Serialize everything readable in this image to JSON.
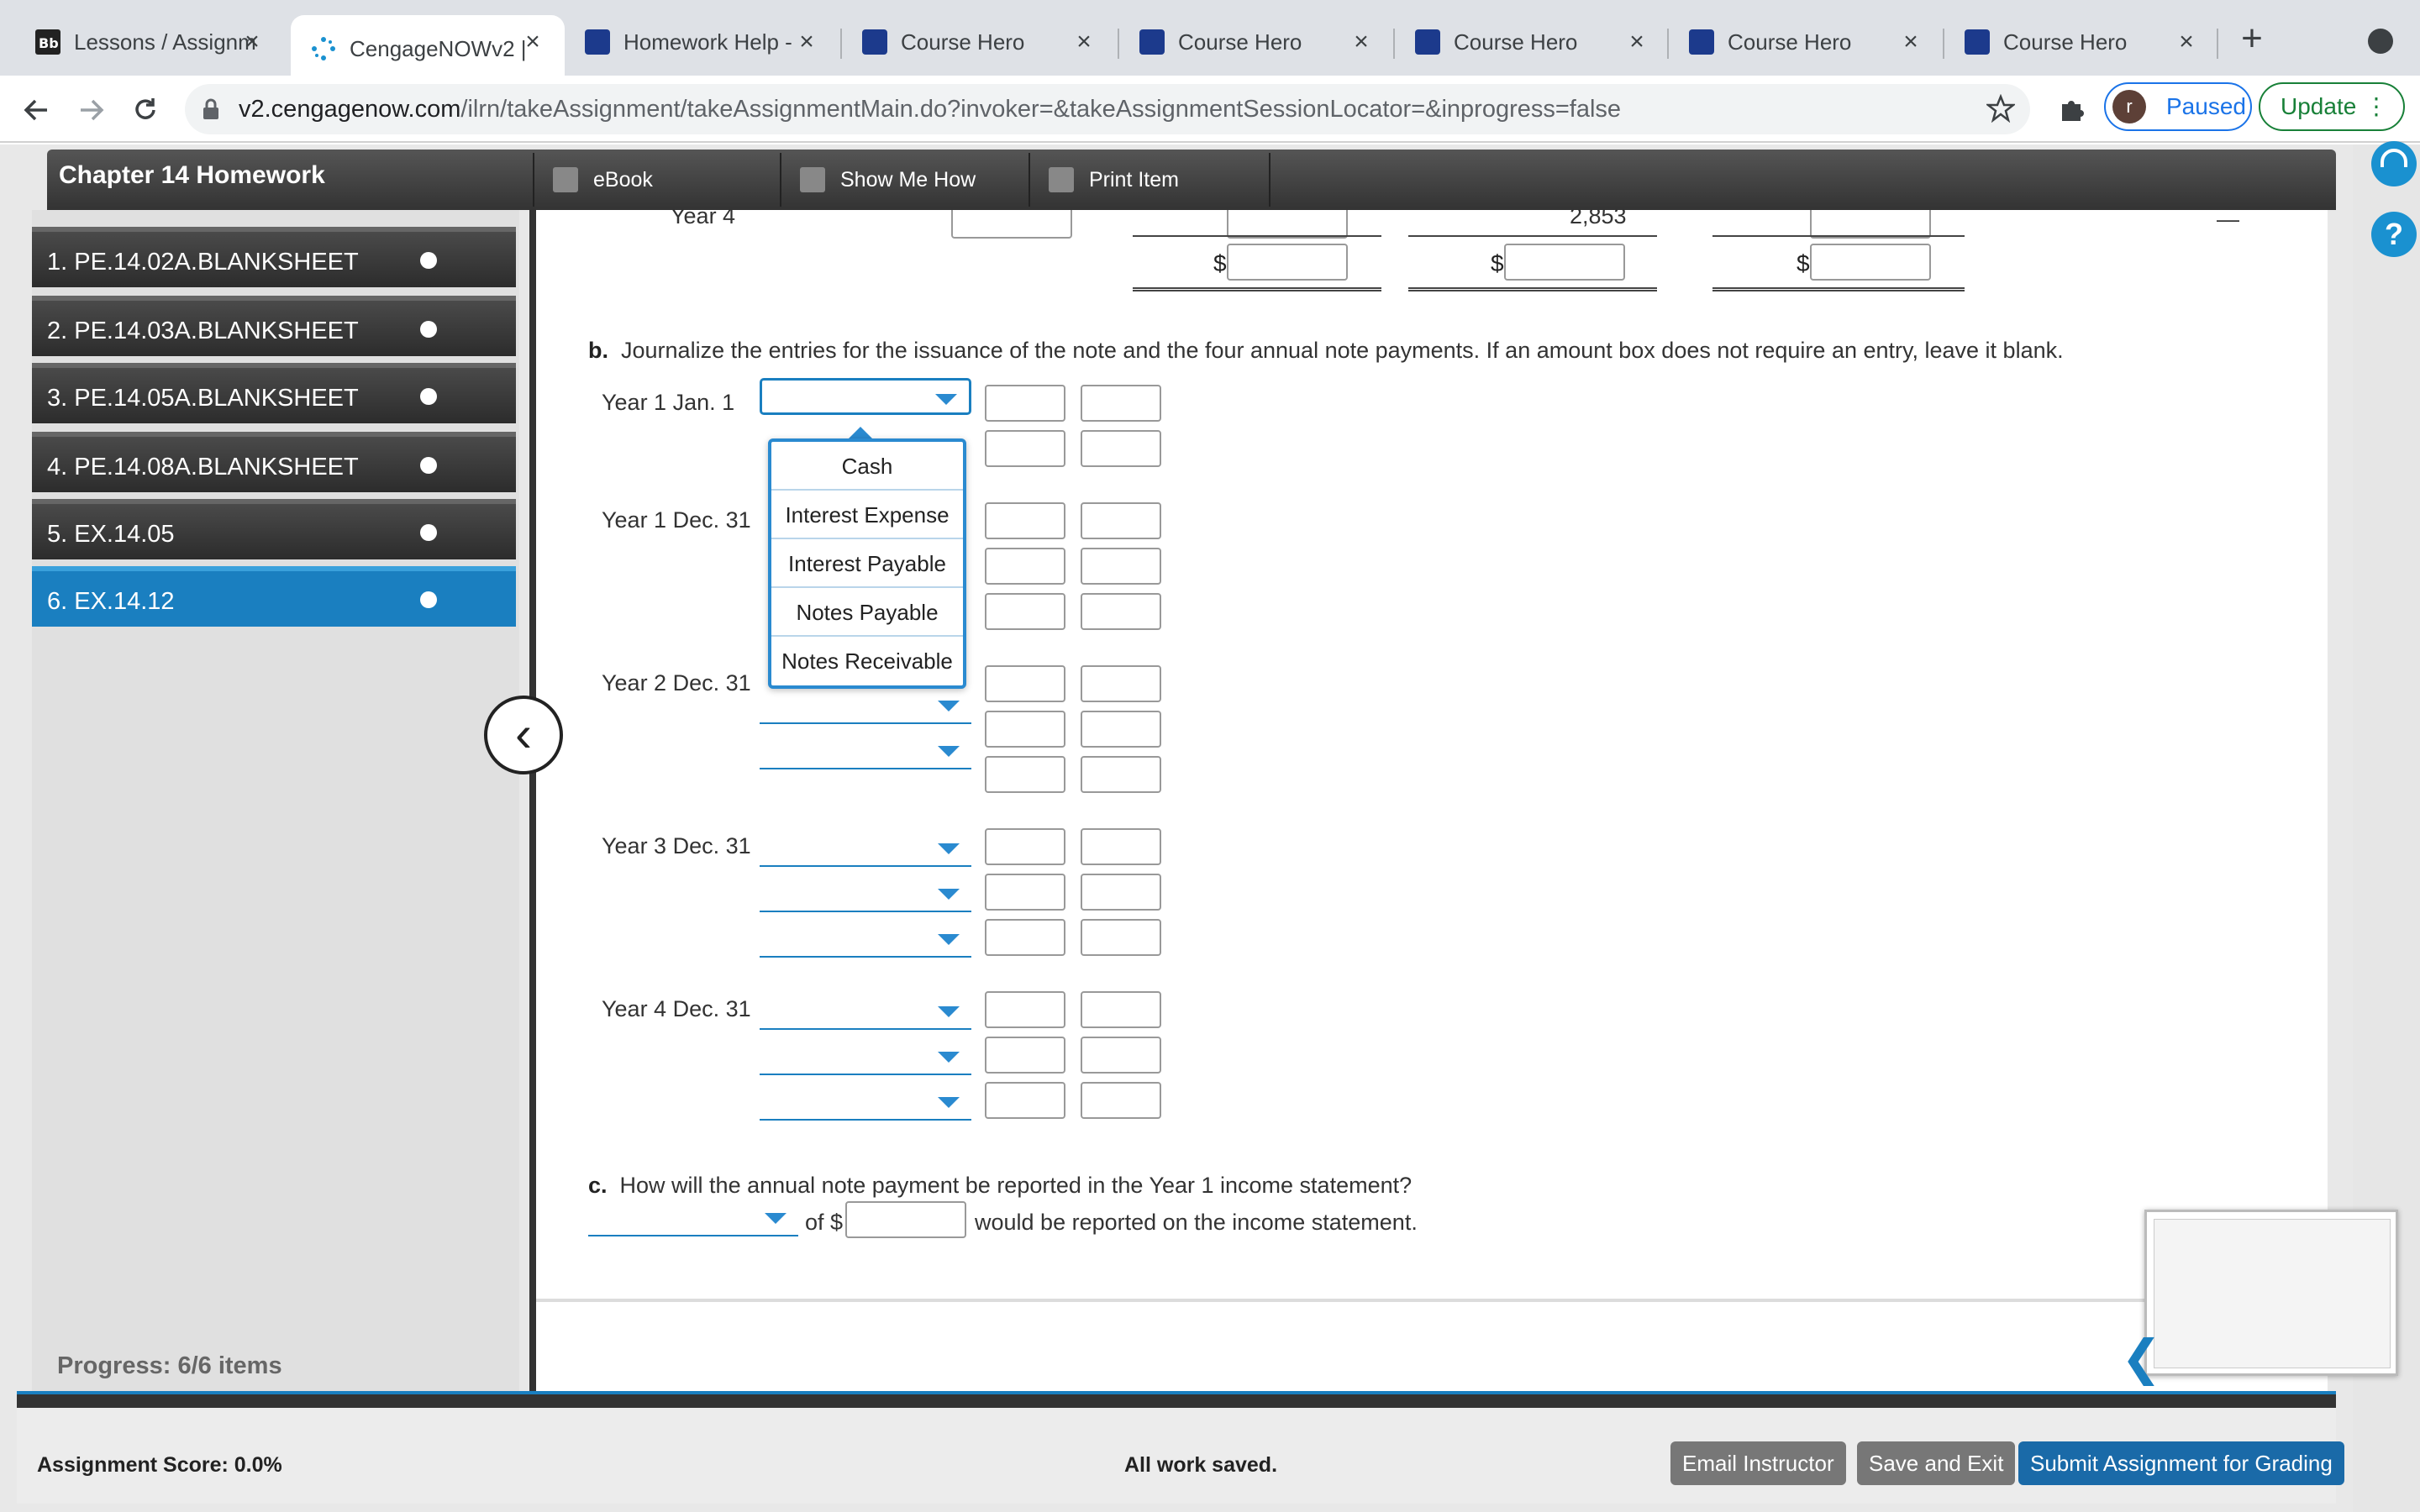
{
  "browser": {
    "tabs": [
      {
        "title": "Lessons / Assignm",
        "icon": "blackboard-icon"
      },
      {
        "title": "CengageNOWv2 |",
        "icon": "cengage-icon",
        "active": true
      },
      {
        "title": "Homework Help -",
        "icon": "coursehero-icon"
      },
      {
        "title": "Course Hero",
        "icon": "coursehero-icon"
      },
      {
        "title": "Course Hero",
        "icon": "coursehero-icon"
      },
      {
        "title": "Course Hero",
        "icon": "coursehero-icon"
      },
      {
        "title": "Course Hero",
        "icon": "coursehero-icon"
      },
      {
        "title": "Course Hero",
        "icon": "coursehero-icon"
      }
    ],
    "url_host": "v2.cengagenow.com",
    "url_path": "/ilrn/takeAssignment/takeAssignmentMain.do?invoker=&takeAssignmentSessionLocator=&inprogress=false",
    "profile_initial": "r",
    "paused_label": "Paused",
    "update_label": "Update"
  },
  "assignment": {
    "title": "Chapter 14 Homework",
    "toolbar": {
      "ebook": "eBook",
      "show_me_how": "Show Me How",
      "print_item": "Print Item"
    },
    "items": [
      "1. PE.14.02A.BLANKSHEET",
      "2. PE.14.03A.BLANKSHEET",
      "3. PE.14.05A.BLANKSHEET",
      "4. PE.14.08A.BLANKSHEET",
      "5. EX.14.05",
      "6. EX.14.12"
    ],
    "active_item": 5,
    "progress": "Progress:  6/6 items"
  },
  "problem": {
    "top_table": {
      "row_label": "Year 4",
      "value": "2,853",
      "dollar": "$"
    },
    "part_b": {
      "letter": "b.",
      "text": "Journalize the entries for the issuance of the note and the four annual note payments. If an amount box does not require an entry, leave it blank.",
      "entries": [
        {
          "date": "Year 1 Jan. 1",
          "rows": 2
        },
        {
          "date": "Year 1 Dec. 31",
          "rows": 3
        },
        {
          "date": "Year 2 Dec. 31",
          "rows": 3
        },
        {
          "date": "Year 3 Dec. 31",
          "rows": 3
        },
        {
          "date": "Year 4 Dec. 31",
          "rows": 3
        }
      ],
      "dropdown_options": [
        "Cash",
        "Interest Expense",
        "Interest Payable",
        "Notes Payable",
        "Notes Receivable"
      ]
    },
    "part_c": {
      "letter": "c.",
      "question": "How will the annual note payment be reported in the Year 1 income statement?",
      "of_label": "of $",
      "suffix": "would be reported on the income statement."
    }
  },
  "footer": {
    "score": "Assignment Score: 0.0%",
    "status": "All work saved.",
    "email": "Email Instructor",
    "save_exit": "Save and Exit",
    "submit": "Submit Assignment for Grading"
  },
  "colors": {
    "accent": "#1a7fc0",
    "header_dark": "#333333",
    "submit": "#1a6aa8"
  }
}
